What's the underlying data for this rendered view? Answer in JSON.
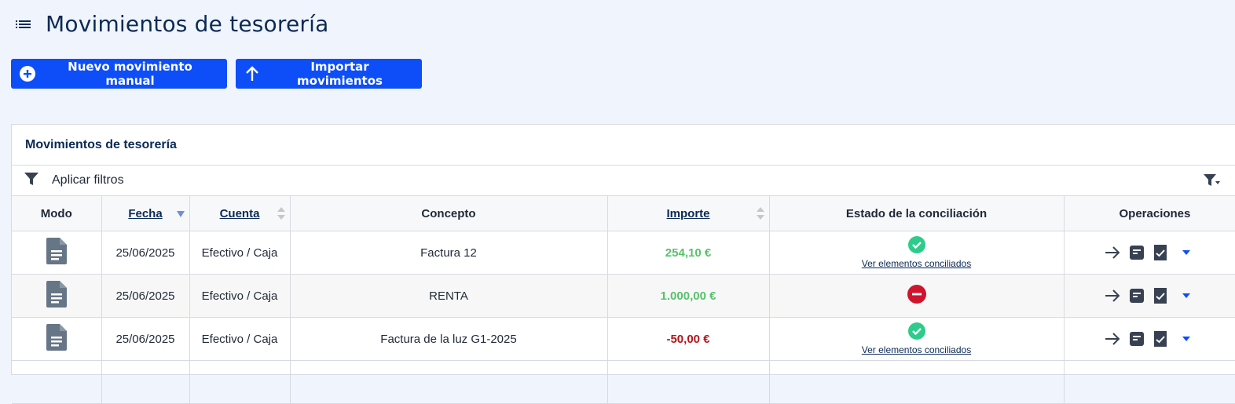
{
  "page": {
    "title": "Movimientos de tesorería"
  },
  "toolbar": {
    "new_label": "Nuevo movimiento manual",
    "import_label": "Importar movimientos"
  },
  "panel": {
    "title": "Movimientos de tesorería",
    "filter_label": "Aplicar filtros"
  },
  "table": {
    "headers": {
      "modo": "Modo",
      "fecha": "Fecha",
      "cuenta": "Cuenta",
      "concepto": "Concepto",
      "importe": "Importe",
      "estado": "Estado de la conciliación",
      "operaciones": "Operaciones"
    },
    "rows": [
      {
        "fecha": "25/06/2025",
        "cuenta": "Efectivo / Caja",
        "concepto": "Factura 12",
        "importe": "254,10 €",
        "estado": "conciliado",
        "link": "Ver elementos conciliados"
      },
      {
        "fecha": "25/06/2025",
        "cuenta": "Efectivo / Caja",
        "concepto": "RENTA",
        "importe": "1.000,00 €",
        "estado": "no-conciliado",
        "link": ""
      },
      {
        "fecha": "25/06/2025",
        "cuenta": "Efectivo / Caja",
        "concepto": "Factura de la luz G1-2025",
        "importe": "-50,00 €",
        "estado": "conciliado",
        "link": "Ver elementos conciliados"
      }
    ]
  },
  "colors": {
    "primary": "#0d4ef8",
    "positive": "#56c26b",
    "negative": "#b3161c",
    "success": "#2ecc8a",
    "danger": "#d0142c"
  },
  "icons": [
    "menu-icon",
    "add-circle-icon",
    "upload-arrow-icon",
    "filter-icon",
    "filter-dropdown-icon",
    "document-icon",
    "check-circle-icon",
    "minus-circle-icon",
    "arrow-right-icon",
    "note-icon",
    "document-check-icon",
    "caret-down-icon"
  ]
}
